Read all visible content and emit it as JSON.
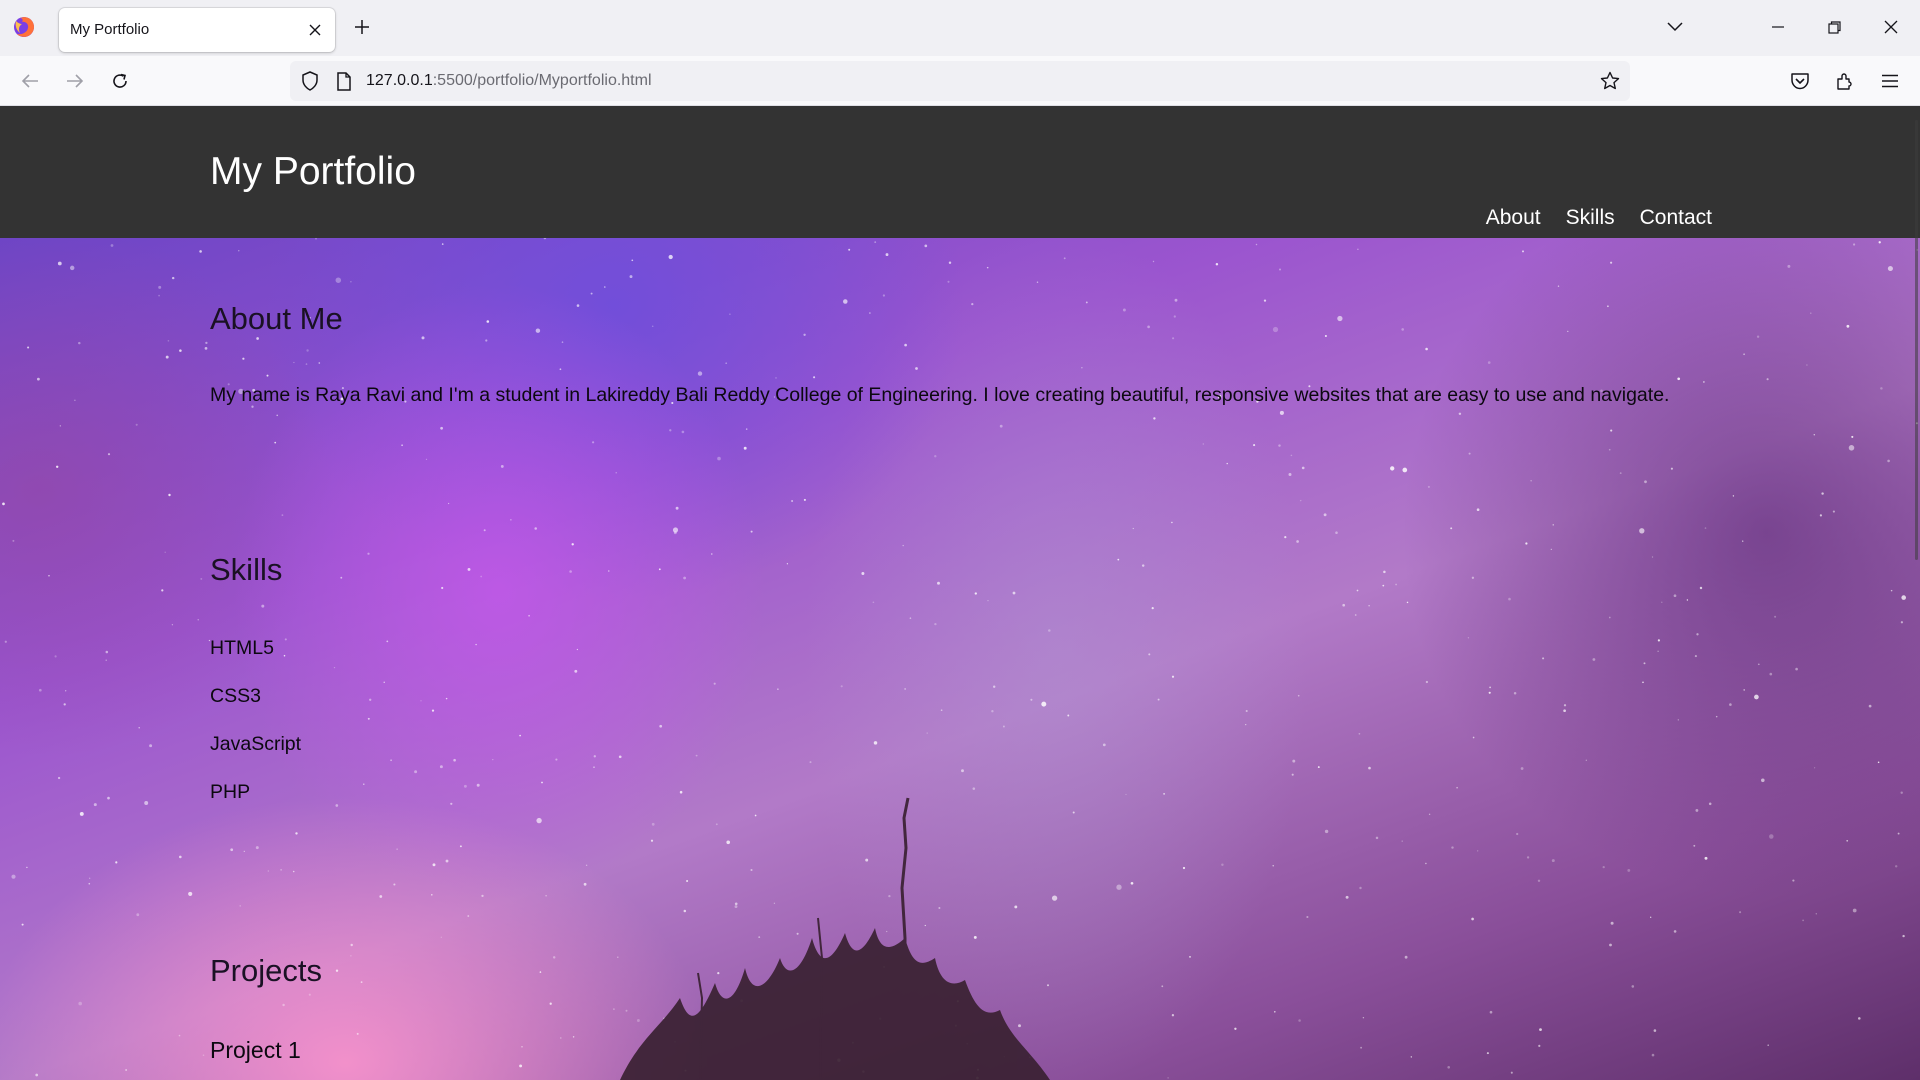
{
  "browser": {
    "tab_title": "My Portfolio",
    "url_host": "127.0.0.1",
    "url_path": ":5500/portfolio/Myportfolio.html"
  },
  "header": {
    "title": "My Portfolio",
    "nav": {
      "about": "About",
      "skills": "Skills",
      "contact": "Contact"
    }
  },
  "about": {
    "heading": "About Me",
    "text": "My name is Raya Ravi and I'm a student in Lakireddy Bali Reddy College of Engineering. I love creating beautiful, responsive websites that are easy to use and navigate."
  },
  "skills": {
    "heading": "Skills",
    "items": [
      "HTML5",
      "CSS3",
      "JavaScript",
      "PHP"
    ]
  },
  "projects": {
    "heading": "Projects",
    "items": [
      "Project 1"
    ]
  },
  "colors": {
    "header_bg": "#333333",
    "header_text": "#ffffff",
    "browser_chrome": "#f0f0f4"
  },
  "icons": [
    "firefox-logo-icon",
    "close-icon",
    "plus-icon",
    "chevron-down-icon",
    "minimize-icon",
    "restore-icon",
    "back-icon",
    "forward-icon",
    "reload-icon",
    "shield-icon",
    "page-icon",
    "star-icon",
    "pocket-icon",
    "extensions-icon",
    "menu-icon"
  ]
}
